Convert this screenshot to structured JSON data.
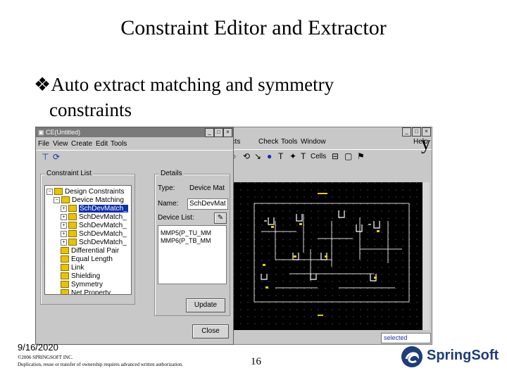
{
  "slide": {
    "title": "Constraint Editor and Extractor",
    "bullet1_line1": "Auto extract matching and symmetry",
    "bullet1_line2": "constraints",
    "bullet2_tail": "y",
    "bullet_glyph": "❖",
    "date": "9/16/2020",
    "copyright1": "©2006 SPRINGSOFT INC.",
    "copyright2": "Duplication, reuse or transfer of ownership requires advanced written authorization.",
    "page_number": "16",
    "logo_text": "SpringSoft",
    "logo_icon": "springsoft-swirl-icon"
  },
  "schematic_window": {
    "menu": [
      "ects",
      "Check",
      "Tools",
      "Window",
      "Help"
    ],
    "toolbar_text": "Cells",
    "status_selected": "selected"
  },
  "dialog": {
    "title": "CE(Untitled)",
    "menu": [
      "File",
      "View",
      "Create",
      "Edit",
      "Tools"
    ],
    "constraint_list_label": "Constraint List",
    "details_label": "Details",
    "tree": {
      "root": "Design Constraints",
      "device_matching": "Device Matching",
      "matches": [
        "SchDevMatch_",
        "SchDevMatch_",
        "SchDevMatch_",
        "SchDevMatch_",
        "SchDevMatch_"
      ],
      "others": [
        "Differential Pair",
        "Equal Length",
        "Link",
        "Shielding",
        "Symmetry",
        "Net Property"
      ]
    },
    "type_label": "Type:",
    "type_value": "Device Mat",
    "name_label": "Name:",
    "name_value": "SchDevMat",
    "device_list_label": "Device List:",
    "device_list": [
      "MMP5(P_TU_MM",
      "MMP6(P_TB_MM"
    ],
    "update_button": "Update",
    "close_button": "Close"
  },
  "colors": {
    "window_bg": "#c8c8c8",
    "canvas_bg": "#000000",
    "title_bar": "#7a7a7a",
    "logo_blue": "#1e3d7a",
    "folder": "#e8c400"
  }
}
